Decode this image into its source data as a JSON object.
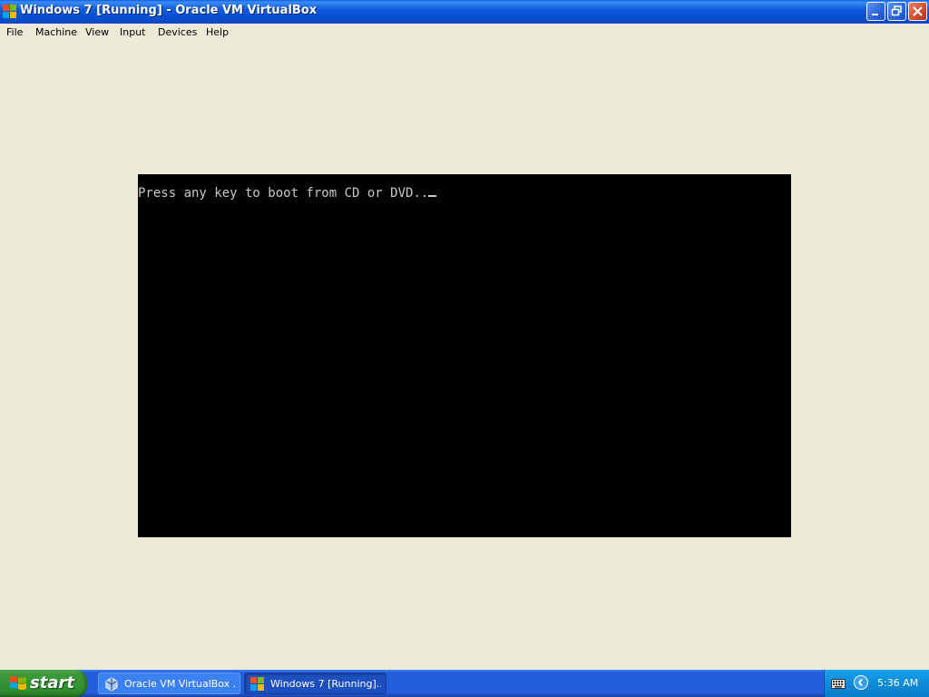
{
  "window": {
    "title": "Windows 7 [Running] - Oracle VM VirtualBox"
  },
  "menu": {
    "items": [
      {
        "label": "File"
      },
      {
        "label": "Machine"
      },
      {
        "label": "View"
      },
      {
        "label": "Input"
      },
      {
        "label": "Devices"
      },
      {
        "label": "Help"
      }
    ]
  },
  "vm": {
    "console_text": "Press any key to boot from CD or DVD.."
  },
  "taskbar": {
    "start_label": "start",
    "tasks": [
      {
        "label": "Oracle VM VirtualBox ...",
        "state": "inactive"
      },
      {
        "label": "Windows 7 [Running]...",
        "state": "active"
      }
    ],
    "clock": "5:36 AM"
  },
  "colors": {
    "titlebar": "#0651D4",
    "vm_screen": "#000000",
    "console_text": "#C8C8C8",
    "chrome_background": "#ECE9D8",
    "taskbar": "#245EDB",
    "start_button": "#3C9A3C",
    "close_button": "#D2492A"
  }
}
